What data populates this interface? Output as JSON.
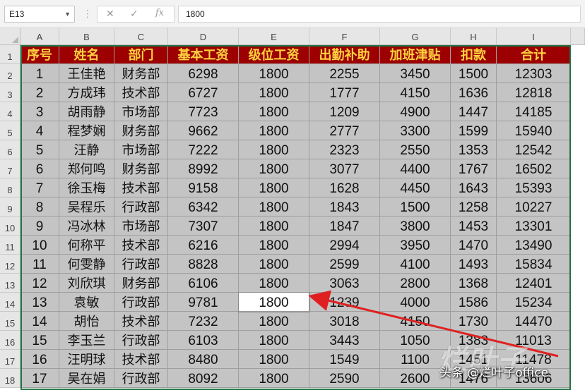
{
  "formula_bar": {
    "name_box": "E13",
    "formula_value": "1800",
    "cancel_icon": "close-icon",
    "enter_icon": "check-icon",
    "function_icon": "fx-icon"
  },
  "columns": [
    "A",
    "B",
    "C",
    "D",
    "E",
    "F",
    "G",
    "H",
    "I"
  ],
  "row_numbers": [
    "1",
    "2",
    "3",
    "4",
    "5",
    "6",
    "7",
    "8",
    "9",
    "10",
    "11",
    "12",
    "13",
    "14",
    "15",
    "16",
    "17",
    "18"
  ],
  "table": {
    "headers": [
      "序号",
      "姓名",
      "部门",
      "基本工资",
      "级位工资",
      "出勤补助",
      "加班津贴",
      "扣款",
      "合计"
    ],
    "rows": [
      [
        "1",
        "王佳艳",
        "财务部",
        "6298",
        "1800",
        "2255",
        "3450",
        "1500",
        "12303"
      ],
      [
        "2",
        "方成玮",
        "技术部",
        "6727",
        "1800",
        "1777",
        "4150",
        "1636",
        "12818"
      ],
      [
        "3",
        "胡雨静",
        "市场部",
        "7723",
        "1800",
        "1209",
        "4900",
        "1447",
        "14185"
      ],
      [
        "4",
        "程梦娴",
        "财务部",
        "9662",
        "1800",
        "2777",
        "3300",
        "1599",
        "15940"
      ],
      [
        "5",
        "汪静",
        "市场部",
        "7222",
        "1800",
        "2323",
        "2550",
        "1353",
        "12542"
      ],
      [
        "6",
        "郑何鸣",
        "财务部",
        "8992",
        "1800",
        "3077",
        "4400",
        "1767",
        "16502"
      ],
      [
        "7",
        "徐玉梅",
        "技术部",
        "9158",
        "1800",
        "1628",
        "4450",
        "1643",
        "15393"
      ],
      [
        "8",
        "吴程乐",
        "行政部",
        "6342",
        "1800",
        "1843",
        "1500",
        "1258",
        "10227"
      ],
      [
        "9",
        "冯冰林",
        "市场部",
        "7307",
        "1800",
        "1847",
        "3800",
        "1453",
        "13301"
      ],
      [
        "10",
        "何称平",
        "技术部",
        "6216",
        "1800",
        "2994",
        "3950",
        "1470",
        "13490"
      ],
      [
        "11",
        "何雯静",
        "行政部",
        "8828",
        "1800",
        "2599",
        "4100",
        "1493",
        "15834"
      ],
      [
        "12",
        "刘欣琪",
        "财务部",
        "6106",
        "1800",
        "3063",
        "2800",
        "1368",
        "12401"
      ],
      [
        "13",
        "袁敏",
        "行政部",
        "9781",
        "1800",
        "1239",
        "4000",
        "1586",
        "15234"
      ],
      [
        "14",
        "胡怡",
        "技术部",
        "7232",
        "1800",
        "3018",
        "4150",
        "1730",
        "14470"
      ],
      [
        "15",
        "李玉兰",
        "行政部",
        "6103",
        "1800",
        "3443",
        "1050",
        "1383",
        "11013"
      ],
      [
        "16",
        "汪明球",
        "技术部",
        "8480",
        "1800",
        "1549",
        "1100",
        "1451",
        "11478"
      ],
      [
        "17",
        "吴在娟",
        "行政部",
        "8092",
        "1800",
        "2590",
        "2600",
        "1476",
        "13606"
      ]
    ]
  },
  "active_cell": {
    "row": 12,
    "col": 4
  },
  "colors": {
    "header_fill": "#9c0000",
    "header_text": "#ffd23f",
    "cell_fill": "#c4c4c4",
    "selection_border": "#217346",
    "arrow": "#e02020"
  },
  "watermark": {
    "logo_text": "烂叶子",
    "caption": "头条 @烂叶子office"
  }
}
